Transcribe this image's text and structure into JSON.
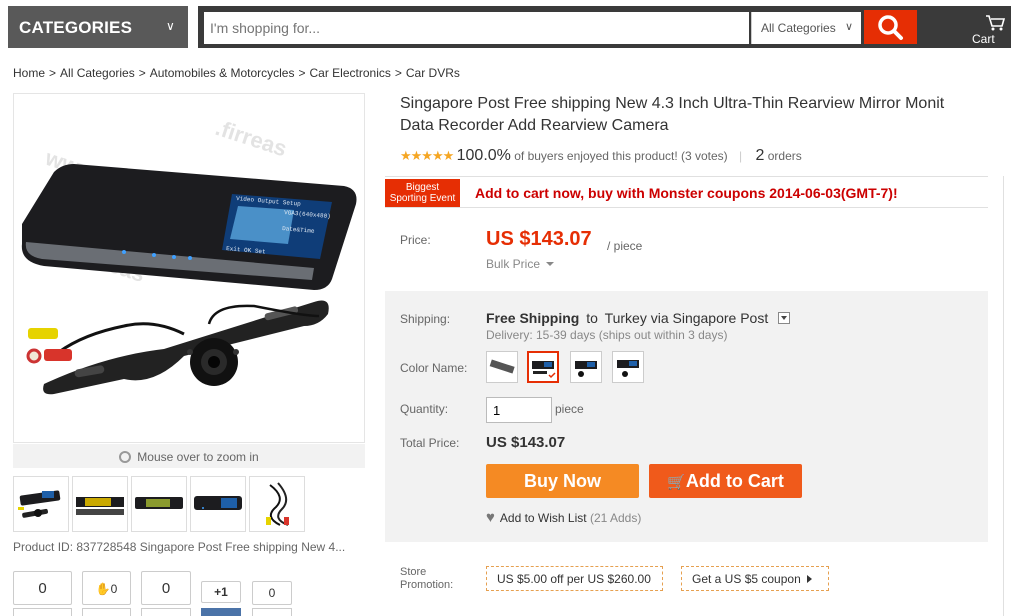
{
  "header": {
    "categories_label": "CATEGORIES",
    "search_placeholder": "I'm shopping for...",
    "search_category": "All Categories",
    "cart_label": "Cart"
  },
  "breadcrumb": [
    "Home",
    "All Categories",
    "Automobiles & Motorcycles",
    "Car Electronics",
    "Car DVRs"
  ],
  "gallery": {
    "zoom_hint": "Mouse over to zoom in",
    "product_id_text": "Product ID: 837728548 Singapore Post Free shipping New 4..."
  },
  "social": {
    "count1": "0",
    "like": "0",
    "count2": "0",
    "plusone": "+1",
    "count3": "0"
  },
  "product": {
    "title_line1": "Singapore Post Free shipping New 4.3 Inch Ultra-Thin Rearview Mirror Monit",
    "title_line2": "Data Recorder Add Rearview Camera",
    "stars": "★★★★★",
    "rating_pct": "100.0%",
    "rating_text": "of buyers enjoyed this product! (3 votes)",
    "orders_count": "2",
    "orders_label": "orders"
  },
  "event": {
    "badge_line1": "Biggest",
    "badge_line2": "Sporting Event",
    "text": "Add to cart now, buy with Monster coupons 2014-06-03(GMT-7)!"
  },
  "price": {
    "label": "Price:",
    "value": "US $143.07",
    "unit": "/ piece",
    "bulk": "Bulk Price"
  },
  "shipping": {
    "label": "Shipping:",
    "free": "Free Shipping",
    "to": "to",
    "destination": "Turkey via Singapore Post",
    "delivery": "Delivery: 15-39 days (ships out within 3 days)"
  },
  "color": {
    "label": "Color Name:",
    "selected_index": 1
  },
  "quantity": {
    "label": "Quantity:",
    "value": "1",
    "unit": "piece"
  },
  "total": {
    "label": "Total Price:",
    "value": "US $143.07"
  },
  "actions": {
    "buy_now": "Buy Now",
    "add_to_cart": "Add to Cart",
    "wishlist": "Add to Wish List",
    "wishlist_count": "(21 Adds)"
  },
  "promotion": {
    "label_line1": "Store",
    "label_line2": "Promotion:",
    "coupon1": "US $5.00 off per US $260.00",
    "coupon2": "Get a US $5 coupon"
  },
  "colors": {
    "accent": "#e62e04",
    "buy_button": "#f58a23",
    "cart_button": "#f05a1b",
    "header_dark": "#3a3a3a",
    "stars": "#f5a623"
  }
}
